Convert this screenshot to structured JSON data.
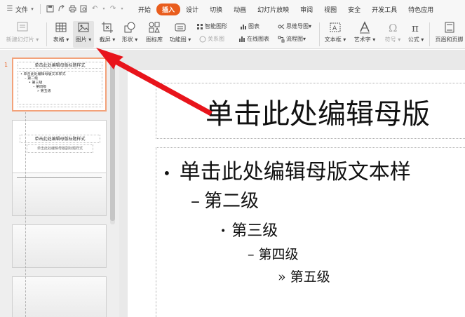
{
  "menubar": {
    "file_label": "文件",
    "tabs": [
      {
        "label": "开始",
        "active": false
      },
      {
        "label": "插入",
        "active": true
      },
      {
        "label": "设计",
        "active": false
      },
      {
        "label": "切换",
        "active": false
      },
      {
        "label": "动画",
        "active": false
      },
      {
        "label": "幻灯片放映",
        "active": false
      },
      {
        "label": "审阅",
        "active": false
      },
      {
        "label": "视图",
        "active": false
      },
      {
        "label": "安全",
        "active": false
      },
      {
        "label": "开发工具",
        "active": false
      },
      {
        "label": "特色应用",
        "active": false
      }
    ]
  },
  "ribbon": {
    "new_slide": "新建幻灯片",
    "table": "表格",
    "picture": "图片",
    "screenshot": "截屏",
    "shape": "形状",
    "icon_library": "图标库",
    "function_chart": "功能图",
    "smart_graphic": "智能图形",
    "chart": "图表",
    "relation_chart": "关系图",
    "online_chart": "在线图表",
    "mind_map": "思维导图",
    "flow_chart": "流程图",
    "textbox": "文本框",
    "wordart": "艺术字",
    "symbol": "符号",
    "formula": "公式",
    "header_footer": "页眉和页脚"
  },
  "thumbnails": {
    "first_number": "1",
    "slide1_title": "单击此处编辑母版标题样式",
    "slide1_body": "单击此处编辑母版文本样式",
    "slide1_levels": [
      "第二级",
      "第三级",
      "第四级",
      "第五级"
    ],
    "slide2_title": "单击此处编辑母版标题样式",
    "slide2_sub": "单击此处编辑母版副标题样式"
  },
  "slide": {
    "title": "单击此处编辑母版",
    "level1": "单击此处编辑母版文本样",
    "level2": "第二级",
    "level3": "第三级",
    "level4": "第四级",
    "level5": "第五级",
    "bullets": [
      "•",
      "–",
      "•",
      "–",
      "»"
    ]
  },
  "colors": {
    "accent": "#e95d1d",
    "arrow": "#e8141b",
    "selection_border": "#f3a27a"
  }
}
